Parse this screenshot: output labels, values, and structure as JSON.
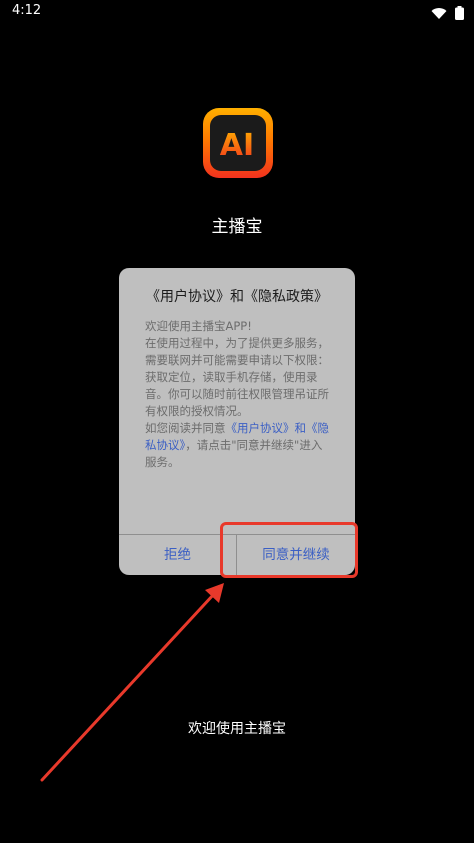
{
  "status_bar": {
    "time": "4:12",
    "icons": [
      "wifi-icon",
      "battery-icon"
    ]
  },
  "app": {
    "name": "主播宝",
    "icon": "app-logo-ai-icon",
    "logo_text": "AI"
  },
  "dialog": {
    "title": "《用户协议》和《隐私政策》",
    "body": {
      "greeting": "欢迎使用主播宝APP!",
      "permissions": "在使用过程中，为了提供更多服务，需要联网并可能需要申请以下权限：获取定位，读取手机存储，使用录音。你可以随时前往权限管理吊证所有权限的授权情况。",
      "consent_prefix": "如您阅读并同意",
      "user_agreement_link": "《用户协议》",
      "and": "和",
      "privacy_link": "《隐私协议》",
      "consent_suffix": "，请点击\"同意并继续\"进入服务。"
    },
    "buttons": {
      "refuse": "拒绝",
      "agree": "同意并继续"
    }
  },
  "footer": {
    "welcome_text": "欢迎使用主播宝"
  },
  "colors": {
    "background": "#000000",
    "dialog": "#bfbfbf",
    "link": "#3b5fc4",
    "annotation": "#e8392b",
    "logo_gradient_top": "#ffb000",
    "logo_gradient_bottom": "#f2321e"
  }
}
